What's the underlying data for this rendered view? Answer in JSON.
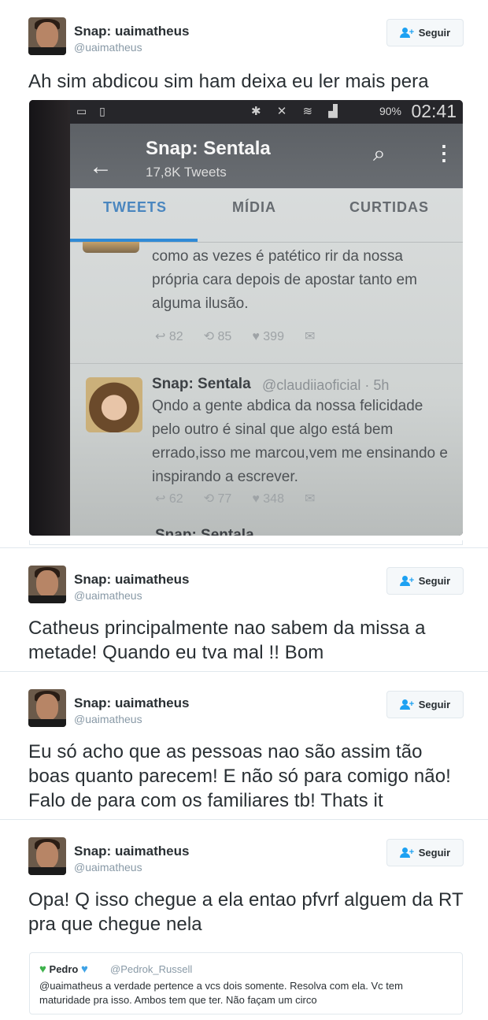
{
  "follow_label": "Seguir",
  "tweets": [
    {
      "display_name": "Snap: uaimatheus",
      "handle": "@uaimatheus",
      "text": "Ah sim abdicou sim ham deixa eu ler mais pera"
    },
    {
      "display_name": "Snap: uaimatheus",
      "handle": "@uaimatheus",
      "text": "Catheus principalmente nao sabem da missa a metade! Quando eu tva mal !! Bom"
    },
    {
      "display_name": "Snap: uaimatheus",
      "handle": "@uaimatheus",
      "text": "Eu só acho que as pessoas nao são assim tão boas quanto parecem! E não só para comigo não! Falo de para com os familiares tb! Thats it"
    },
    {
      "display_name": "Snap: uaimatheus",
      "handle": "@uaimatheus",
      "text": "Opa! Q isso chegue a ela entao pfvrf alguem da RT pra que chegue nela"
    }
  ],
  "embedded_screenshot": {
    "status_time": "02:41",
    "status_battery": "90%",
    "profile_name": "Snap: Sentala",
    "profile_tweets": "17,8K Tweets",
    "tabs": [
      "TWEETS",
      "MÍDIA",
      "CURTIDAS"
    ],
    "tweet1_text": "como as vezes é patético rir da nossa própria cara depois de apostar tanto em alguma ilusão.",
    "tweet1_replies": "82",
    "tweet1_retweets": "85",
    "tweet1_likes": "399",
    "tweet2_name": "Snap: Sentala",
    "tweet2_handle": "@claudiiaoficial · 5h",
    "tweet2_text": "Qndo a gente abdica da nossa felicidade pelo outro é sinal que algo está bem errado,isso me marcou,vem me ensinando e inspirando a escrever.",
    "tweet2_replies": "62",
    "tweet2_retweets": "77",
    "tweet2_likes": "348",
    "tweet3_name": "Snap: Sentala"
  },
  "quoted_tweet": {
    "name": "Pedro",
    "handle": "@Pedrok_Russell",
    "text": "@uaimatheus a verdade pertence a vcs dois somente. Resolva com ela. Vc tem maturidade pra isso. Ambos tem que ter. Não façam um circo"
  },
  "colors": {
    "accent": "#1da1f2",
    "text": "#292f33",
    "muted": "#8899a6",
    "border": "#e1e8ed"
  }
}
